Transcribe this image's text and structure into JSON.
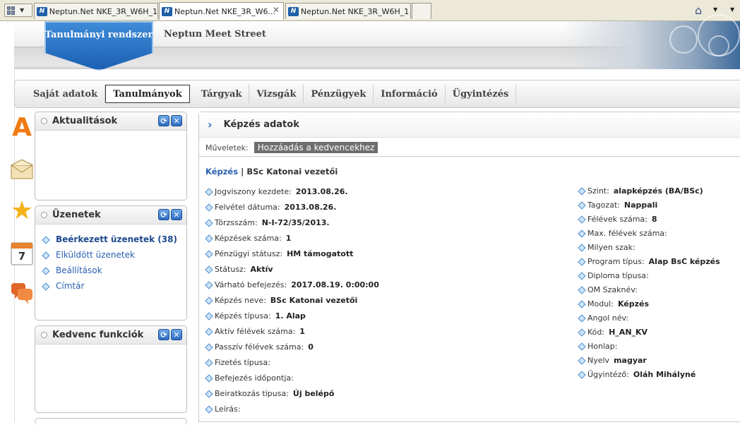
{
  "browser": {
    "tabs": [
      {
        "label": "Neptun.Net NKE_3R_W6H_1",
        "active": false
      },
      {
        "label": "Neptun.Net NKE_3R_W6...",
        "active": true
      },
      {
        "label": "Neptun.Net NKE_3R_W6H_1",
        "active": false
      }
    ],
    "favicon_letter": "N",
    "close_glyph": "✕"
  },
  "header": {
    "badge": "Tanulmányi rendszer",
    "title": "Neptun Meet Street"
  },
  "menu": [
    {
      "label": "Saját adatok"
    },
    {
      "label": "Tanulmányok",
      "active": true
    },
    {
      "label": "Tárgyak"
    },
    {
      "label": "Vizsgák"
    },
    {
      "label": "Pénzügyek"
    },
    {
      "label": "Információ"
    },
    {
      "label": "Ügyintézés"
    }
  ],
  "sidebar_icons": {
    "a_letter": "A",
    "calendar_day": "7",
    "star": "★"
  },
  "panels": {
    "aktualitasok": {
      "title": "Aktualitások"
    },
    "uzenetek": {
      "title": "Üzenetek",
      "items": [
        {
          "label": "Beérkezett üzenetek (38)",
          "bold": true
        },
        {
          "label": "Elküldött üzenetek"
        },
        {
          "label": "Beállítások"
        },
        {
          "label": "Címtár"
        }
      ]
    },
    "kedvenc": {
      "title": "Kedvenc funkciók"
    },
    "panel_btn_refresh": "⟳",
    "panel_btn_close": "✕"
  },
  "main": {
    "title": "Képzés adatok",
    "chevron": "›",
    "ops_label": "Műveletek:",
    "ops_button": "Hozzáadás a kedvencekhez",
    "crumb_link": "Képzés",
    "crumb_sep": "|",
    "crumb_value": "BSc Katonai vezetői",
    "left_fields": [
      {
        "label": "Jogviszony kezdete:",
        "value": "2013.08.26."
      },
      {
        "label": "Felvétel dátuma:",
        "value": "2013.08.26."
      },
      {
        "label": "Törzsszám:",
        "value": "N-I-72/35/2013."
      },
      {
        "label": "Képzések száma:",
        "value": "1"
      },
      {
        "label": "Pénzügyi státusz:",
        "value": "HM támogatott"
      },
      {
        "label": "Státusz:",
        "value": "Aktív"
      },
      {
        "label": "Várható befejezés:",
        "value": "2017.08.19. 0:00:00"
      },
      {
        "label": "Képzés neve:",
        "value": "BSc Katonai vezetői"
      },
      {
        "label": "Képzés típusa:",
        "value": "1. Alap"
      },
      {
        "label": "Aktív félévek száma:",
        "value": "1"
      },
      {
        "label": "Passzív félévek száma:",
        "value": "0"
      },
      {
        "label": "Fizetés típusa:",
        "value": ""
      },
      {
        "label": "Befejezés időpontja:",
        "value": ""
      },
      {
        "label": "Beiratkozás típusa:",
        "value": "Új belépő"
      },
      {
        "label": "Leírás:",
        "value": ""
      }
    ],
    "right_fields": [
      {
        "label": "Szint:",
        "value": "alapképzés (BA/BSc)"
      },
      {
        "label": "Tagozat:",
        "value": "Nappali"
      },
      {
        "label": "Félévek száma:",
        "value": "8"
      },
      {
        "label": "Max. félévek száma:",
        "value": ""
      },
      {
        "label": "Milyen szak:",
        "value": ""
      },
      {
        "label": "Program típus:",
        "value": "Alap BsC képzés"
      },
      {
        "label": "Diploma típusa:",
        "value": ""
      },
      {
        "label": "OM Szaknév:",
        "value": ""
      },
      {
        "label": "Modul:",
        "value": "Képzés"
      },
      {
        "label": "Angol név:",
        "value": ""
      },
      {
        "label": "Kód:",
        "value": "H_AN_KV"
      },
      {
        "label": "Honlap:",
        "value": ""
      },
      {
        "label": "Nyelv",
        "value": "magyar"
      },
      {
        "label": "Ügyintéző:",
        "value": "Oláh Mihályné"
      }
    ]
  }
}
